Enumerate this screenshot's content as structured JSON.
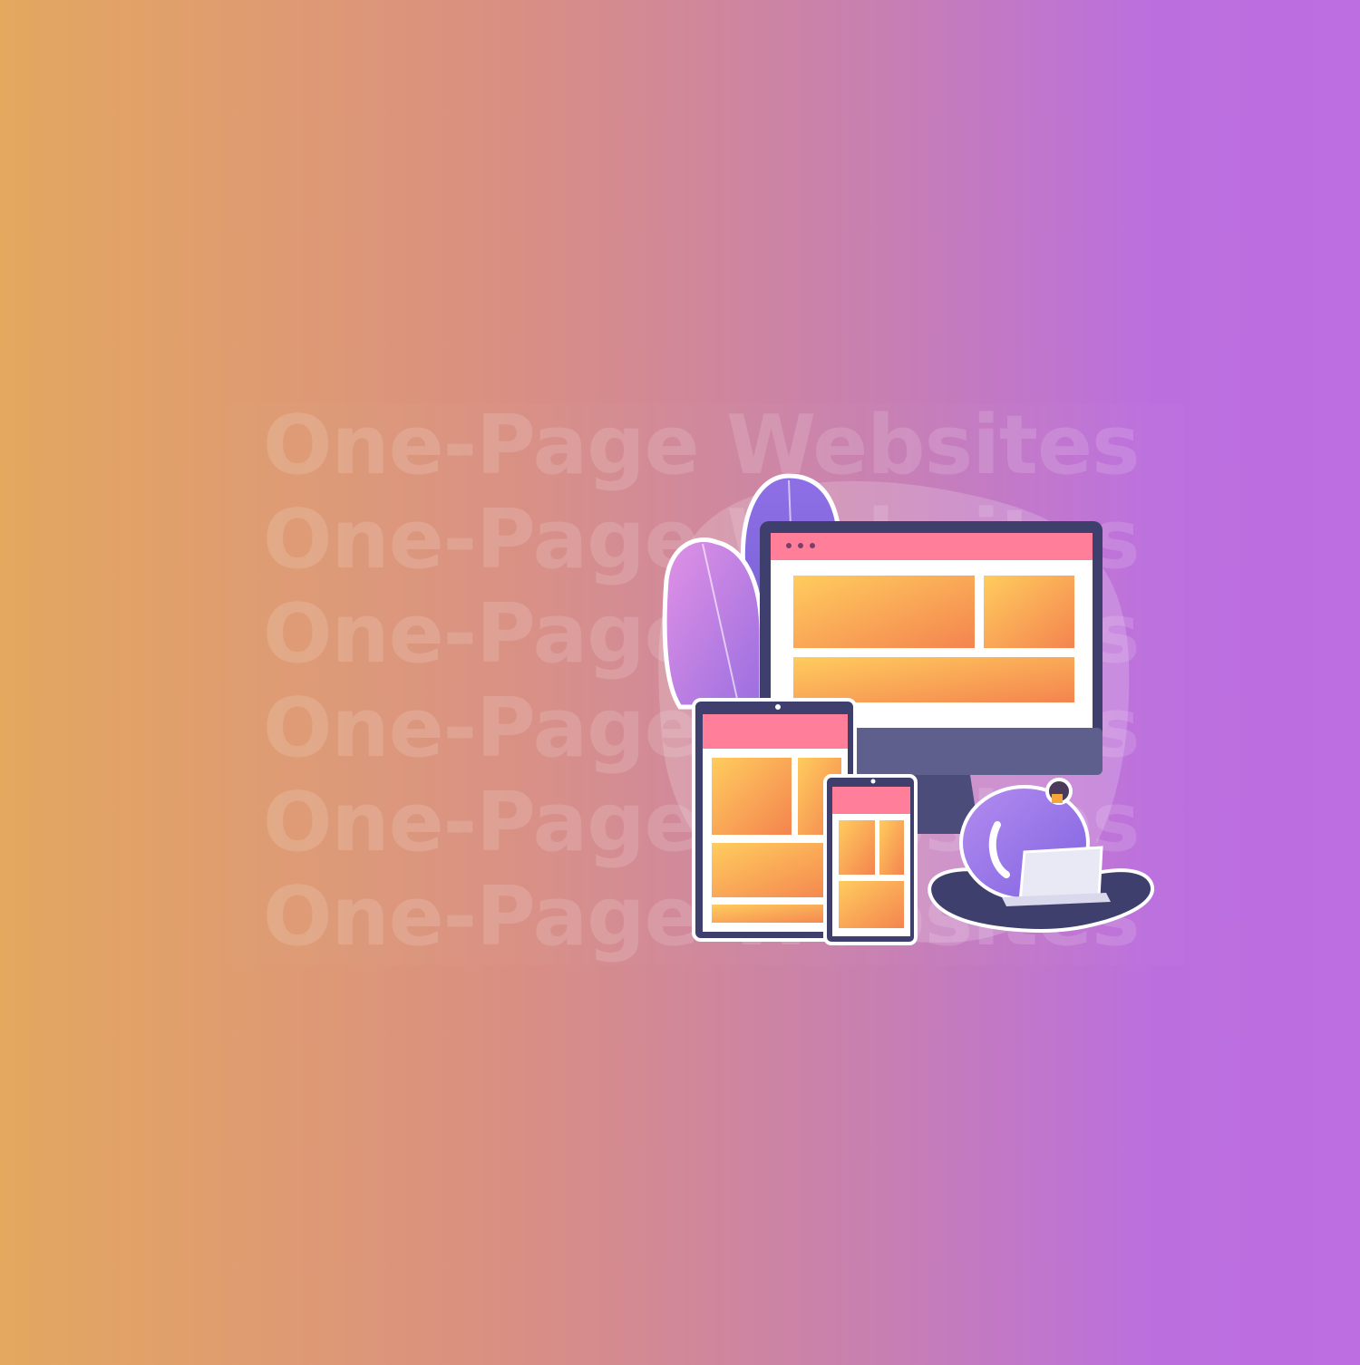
{
  "headline_lines": [
    "One-Page Websites",
    "One-Page Websites",
    "One-Page Websites",
    "One-Page Websites",
    "One-Page Websites",
    "One-Page Websites"
  ],
  "colors": {
    "gradient_left": "#e4a85f",
    "gradient_right": "#bd6ee0",
    "device_frame": "#3e3f6d",
    "header_pink": "#ff7f9b",
    "content_orange": "#ffb14e"
  },
  "illustration": {
    "icon": "responsive-devices-illustration"
  }
}
